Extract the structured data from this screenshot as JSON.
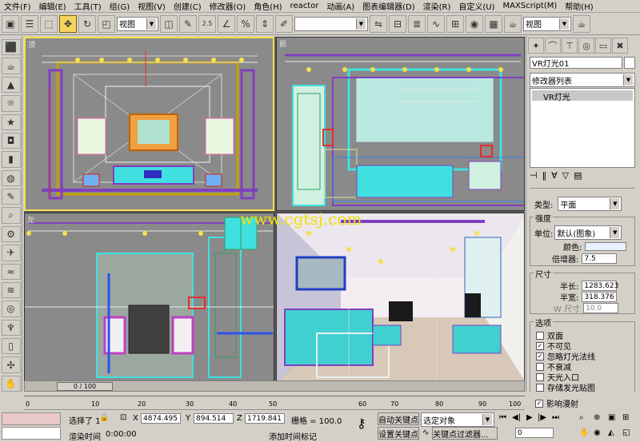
{
  "menu": [
    "文件(F)",
    "编辑(E)",
    "工具(T)",
    "组(G)",
    "视图(V)",
    "创建(C)",
    "修改器(O)",
    "角色(H)",
    "reactor",
    "动画(A)",
    "图表编辑器(D)",
    "渲染(R)",
    "自定义(U)",
    "MAXScript(M)",
    "帮助(H)"
  ],
  "toolbar": {
    "view_combo": "视图",
    "right_view_combo": "视图",
    "snap_label": "2.5"
  },
  "viewports": {
    "top": "顶",
    "front": "前",
    "left": "左",
    "perspective": ""
  },
  "watermark": "www.cgtsj.com",
  "command_panel": {
    "object_name": "VR灯光01",
    "modifier_list": "修改器列表",
    "stack_item": "VR灯光",
    "type_label": "类型:",
    "type_value": "平面",
    "intensity_title": "强度",
    "unit_label": "单位:",
    "unit_value": "默认(图象)",
    "color_label": "颜色:",
    "multiplier_label": "倍增器:",
    "multiplier_value": "7.5",
    "size_title": "尺寸",
    "half_length_label": "半长:",
    "half_length_value": "1283.623",
    "half_width_label": "半宽:",
    "half_width_value": "318.376",
    "w_size_label": "W 尺寸",
    "w_size_value": "10.0",
    "options_title": "选项",
    "options": [
      {
        "label": "双面",
        "checked": false
      },
      {
        "label": "不可见",
        "checked": true
      },
      {
        "label": "忽略灯光法线",
        "checked": true
      },
      {
        "label": "不衰减",
        "checked": false
      },
      {
        "label": "天光入口",
        "checked": false
      },
      {
        "label": "存储发光贴图",
        "checked": false
      },
      {
        "label": "影响漫射",
        "checked": true
      }
    ]
  },
  "timeline": {
    "slider": "0 / 100",
    "ticks": [
      "0",
      "10",
      "20",
      "30",
      "40",
      "50",
      "60",
      "70",
      "80",
      "90",
      "100"
    ]
  },
  "status": {
    "selected": "选择了 1",
    "x_label": "X",
    "x_value": "4874.495",
    "y_label": "Y",
    "y_value": "894.514",
    "z_label": "Z",
    "z_value": "1719.841",
    "grid": "栅格 = 100.0",
    "auto_key": "自动关键点",
    "set_key": "设置关键点",
    "selection_combo": "选定对象",
    "key_filters": "关键点过滤器...",
    "frame": "0",
    "render_time_label": "渲染时间",
    "render_time_value": "0:00:00",
    "add_time_tag": "添加时间标记"
  },
  "colors": {
    "accent": "#f4e04d",
    "watermark": "#f0e000",
    "model_purple": "#8040c0",
    "model_cyan": "#40e0e0"
  }
}
